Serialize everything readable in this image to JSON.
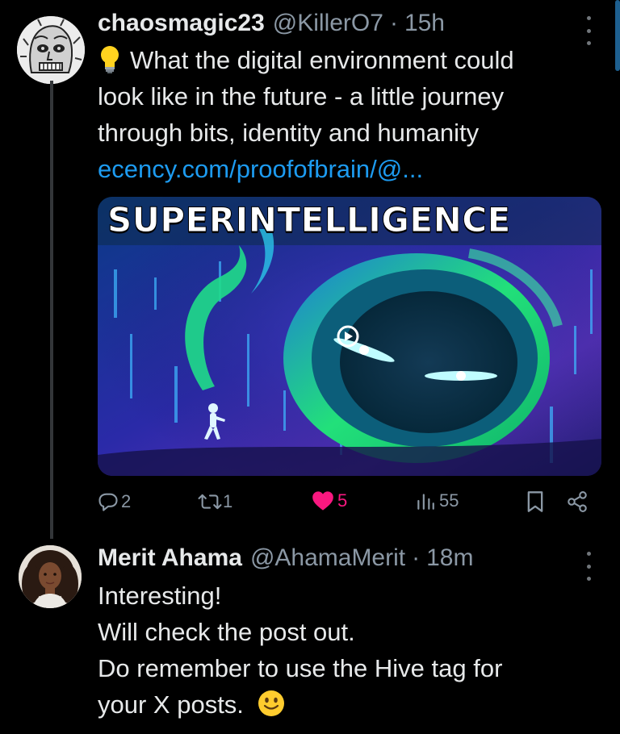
{
  "tweet": {
    "author_name": "chaosmagic23",
    "author_handle": "@KillerO7",
    "separator": "·",
    "time": "15h",
    "text_lines": [
      "What the digital environment could",
      "look like in the future - a little journey",
      "through bits, identity and humanity"
    ],
    "link": "ecency.com/proofofbrain/@...",
    "media_title": "SUPERINTELLIGENCE",
    "stats": {
      "replies": "2",
      "retweets": "1",
      "likes": "5",
      "views": "55"
    },
    "icons": {
      "emoji": "lightbulb-emoji",
      "reply": "reply-icon",
      "retweet": "retweet-icon",
      "like": "heart-icon",
      "views": "views-icon",
      "bookmark": "bookmark-icon",
      "share": "share-icon",
      "play": "play-icon"
    },
    "colors": {
      "like": "#f91880",
      "link": "#1d9bf0",
      "muted": "#8b98a5"
    }
  },
  "reply": {
    "author_name": "Merit Ahama",
    "author_handle": "@AhamaMerit",
    "separator": "·",
    "time": "18m",
    "text_lines": [
      "Interesting!",
      "Will check the post out.",
      "Do remember to use the Hive tag for",
      "your X posts."
    ],
    "emoji": "slightly-smiling-face-emoji"
  }
}
